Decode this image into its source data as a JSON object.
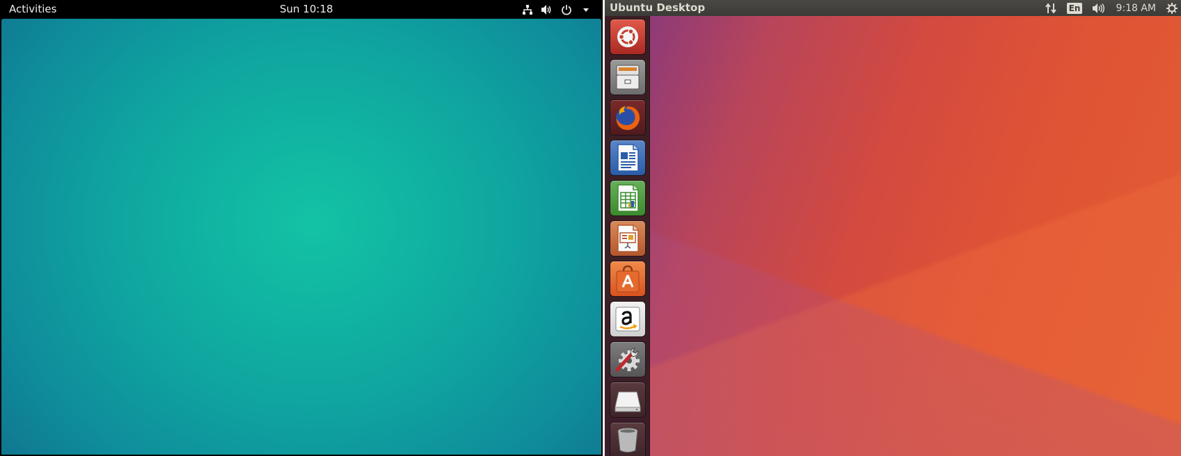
{
  "gnome": {
    "topbar": {
      "activities_label": "Activities",
      "clock": "Sun 10:18",
      "tray_icons": [
        "network-icon",
        "volume-icon",
        "power-icon",
        "dropdown-arrow-icon"
      ]
    },
    "desktop": {
      "wallpaper_colors": [
        "#13c3a4",
        "#10708c"
      ]
    }
  },
  "unity": {
    "panel": {
      "title": "Ubuntu Desktop",
      "input_method": "En",
      "time": "9:18 AM",
      "tray_icons": [
        "network-updown-icon",
        "keyboard-layout-icon",
        "volume-icon",
        "session-gear-icon"
      ]
    },
    "launcher": {
      "items": [
        {
          "name": "dash-home",
          "icon": "ubuntu-logo-icon",
          "color": "#c0392b"
        },
        {
          "name": "files",
          "icon": "file-cabinet-icon",
          "color": "#8a8a8a"
        },
        {
          "name": "firefox",
          "icon": "firefox-icon",
          "color": "#e66000"
        },
        {
          "name": "libreoffice-writer",
          "icon": "writer-document-icon",
          "color": "#2a5ca8"
        },
        {
          "name": "libreoffice-calc",
          "icon": "calc-spreadsheet-icon",
          "color": "#3b8a2e"
        },
        {
          "name": "libreoffice-impress",
          "icon": "impress-presentation-icon",
          "color": "#c0582b"
        },
        {
          "name": "ubuntu-software",
          "icon": "software-bag-icon",
          "color": "#e2622b"
        },
        {
          "name": "amazon",
          "icon": "amazon-icon",
          "color": "#222222"
        },
        {
          "name": "system-settings",
          "icon": "settings-wrench-gear-icon",
          "color": "#777777"
        },
        {
          "name": "removable-drive",
          "icon": "drive-icon",
          "color": "#bbbbbb"
        },
        {
          "name": "trash",
          "icon": "trash-icon",
          "color": "#999999"
        }
      ]
    },
    "desktop": {
      "wallpaper_colors": [
        "#8e3a78",
        "#e25d34"
      ]
    }
  }
}
